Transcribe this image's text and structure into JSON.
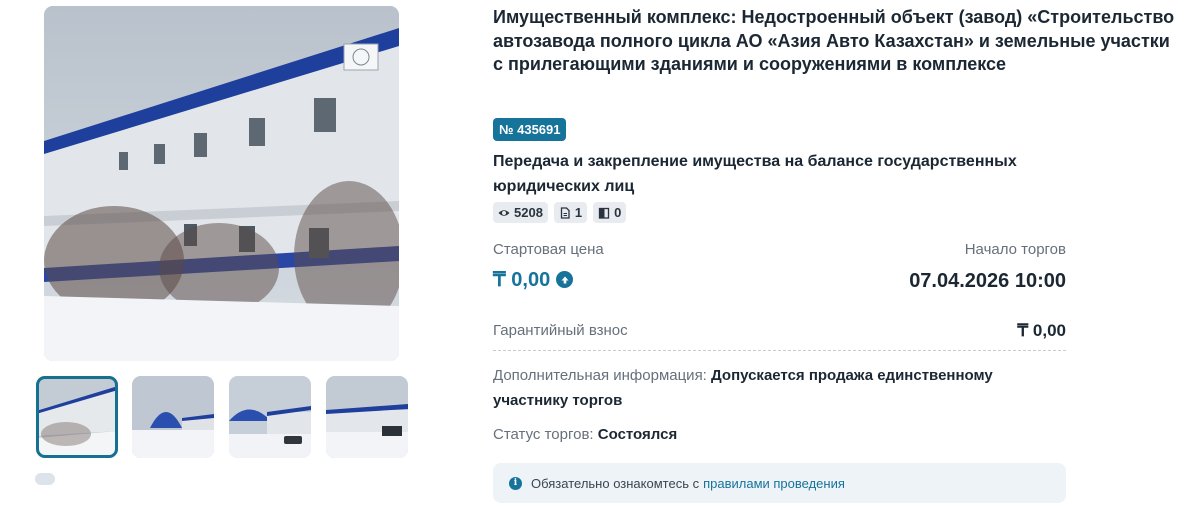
{
  "lot": {
    "title": "Имущественный комплекс: Недостроенный объект (завод) «Строительство автозавода полного цикла АО «Азия Авто Казахстан» и земельные участки с прилегающими зданиями и сооружениями в комплексе",
    "number_badge": "№ 435691",
    "category": "Передача и закрепление имущества на балансе государственных юридических лиц",
    "stats": {
      "views": "5208",
      "documents": "1",
      "applications": "0"
    }
  },
  "pricing": {
    "start_price_label": "Стартовая цена",
    "start_price": "₸ 0,00",
    "trade_start_label": "Начало торгов",
    "trade_start": "07.04.2026 10:00",
    "deposit_label": "Гарантийный взнос",
    "deposit_value": "₸ 0,00"
  },
  "details": {
    "extra_label": "Дополнительная информация:",
    "extra_value": "Допускается продажа единственному участнику торгов",
    "status_label": "Статус торгов:",
    "status_value": "Состоялся"
  },
  "notice": {
    "text": "Обязательно ознакомтесь с",
    "link": "правилами проведения",
    "icon": "i"
  },
  "colors": {
    "accent": "#16739a",
    "text": "#1b2733",
    "muted": "#66707b",
    "notice_bg": "#eef3f8"
  },
  "icons": [
    "eye-icon",
    "document-icon",
    "door-icon",
    "arrow-up-circle-icon",
    "info-icon"
  ]
}
